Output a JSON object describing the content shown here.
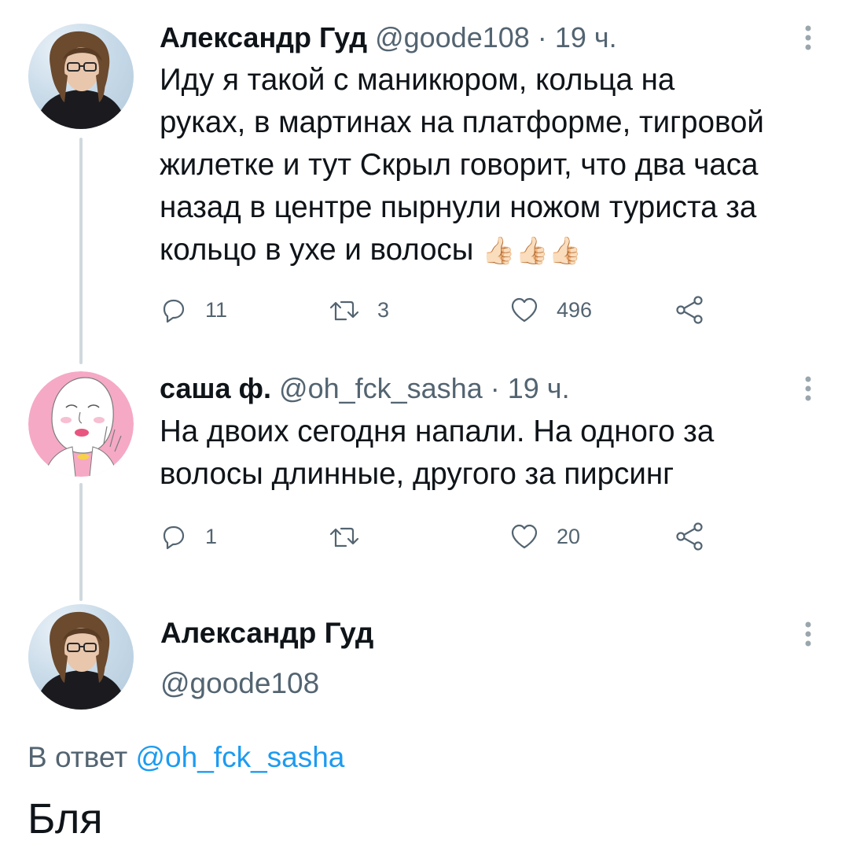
{
  "thread": [
    {
      "author": {
        "name": "Александр Гуд",
        "handle": "@goode108"
      },
      "separator": "·",
      "time": "19 ч.",
      "lines": [
        "Иду я такой с маникюром, кольца на",
        "руках, в мартинах на платформе, тигровой",
        "жилетке и тут Скрыл говорит, что два часа",
        "назад в центре пырнули ножом туриста за",
        "кольцо в ухе и волосы"
      ],
      "emoji": "👍🏻👍🏻👍🏻",
      "stats": {
        "replies": "11",
        "retweets": "3",
        "likes": "496"
      }
    },
    {
      "author": {
        "name": "саша ф.",
        "handle": "@oh_fck_sasha"
      },
      "separator": "·",
      "time": "19 ч.",
      "lines": [
        "На двоих сегодня напали. На одного за",
        "волосы длинные, другого за пирсинг"
      ],
      "stats": {
        "replies": "1",
        "retweets": "",
        "likes": "20"
      }
    }
  ],
  "main_tweet": {
    "author": {
      "name": "Александр Гуд",
      "handle": "@goode108"
    },
    "reply_prefix": "В ответ",
    "reply_handle": "@oh_fck_sasha",
    "text": "Бля"
  },
  "icons": {
    "more": "more-vertical-icon",
    "reply": "reply-icon",
    "retweet": "retweet-icon",
    "like": "heart-icon",
    "share": "share-icon"
  },
  "colors": {
    "text": "#0f1419",
    "secondary": "#536471",
    "link": "#1d9bf0",
    "thread_line": "#cfd9de"
  }
}
